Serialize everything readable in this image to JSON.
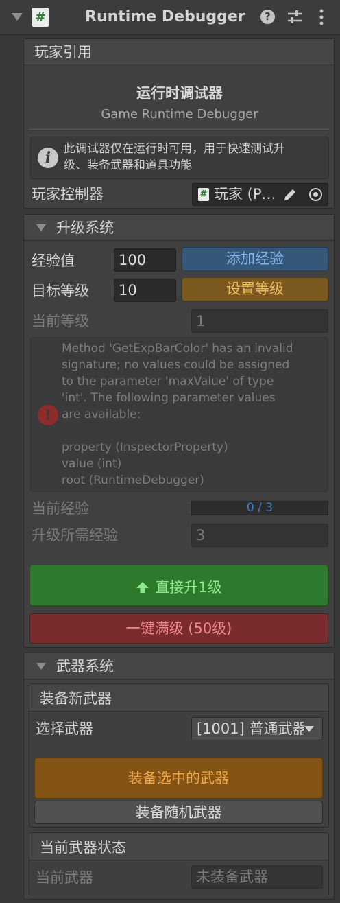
{
  "header": {
    "title": "Runtime Debugger (S",
    "script_glyph": "#",
    "help_glyph": "?",
    "icons": [
      "foldout-arrow-icon",
      "script-icon",
      "help-icon",
      "preset-sliders-icon",
      "more-menu-icon"
    ]
  },
  "player_ref": {
    "section_label": "玩家引用",
    "title": "运行时调试器",
    "subtitle": "Game Runtime Debugger",
    "info_line1": "此调试器仅在运行时可用，用于快速测试升",
    "info_line2": "级、装备武器和道具功能",
    "controller_label": "玩家控制器",
    "controller_value": "玩家 (P…"
  },
  "level_system": {
    "title": "升级系统",
    "exp_label": "经验值",
    "exp_value": "100",
    "add_exp_button": "添加经验",
    "target_level_label": "目标等级",
    "target_level_value": "10",
    "set_level_button": "设置等级",
    "current_level_label": "当前等级",
    "current_level_value": "1",
    "error_lines": [
      "Method 'GetExpBarColor' has an invalid",
      "signature; no values could be assigned",
      "to the parameter 'maxValue' of type",
      "'int'. The following parameter values",
      "are available:",
      "",
      "property (InspectorProperty)",
      "value (int)",
      "root (RuntimeDebugger)"
    ],
    "current_exp_label": "当前经验",
    "current_exp_value": "0 / 3",
    "current_exp_progress": 0,
    "required_exp_label": "升级所需经验",
    "required_exp_value": "3",
    "level_up_button": "直接升1级",
    "max_level_button": "一键满级 (50级)"
  },
  "weapon_system": {
    "title": "武器系统",
    "equip_new": {
      "title": "装备新武器",
      "select_label": "选择武器",
      "select_value": "[1001] 普通武器",
      "equip_selected_button": "装备选中的武器",
      "equip_random_button": "装备随机武器"
    },
    "status": {
      "title": "当前武器状态",
      "current_weapon_label": "当前武器",
      "current_weapon_value": "未装备武器"
    }
  },
  "colors": {
    "add_exp_button": "#35587a",
    "set_level_button": "#7c5a1f",
    "level_up_button": "#2d7a2d",
    "max_level_button": "#7a2b2d",
    "equip_selected_button": "#835414",
    "error_icon": "#8e2b2b",
    "progress_text": "#3f7fc5"
  }
}
